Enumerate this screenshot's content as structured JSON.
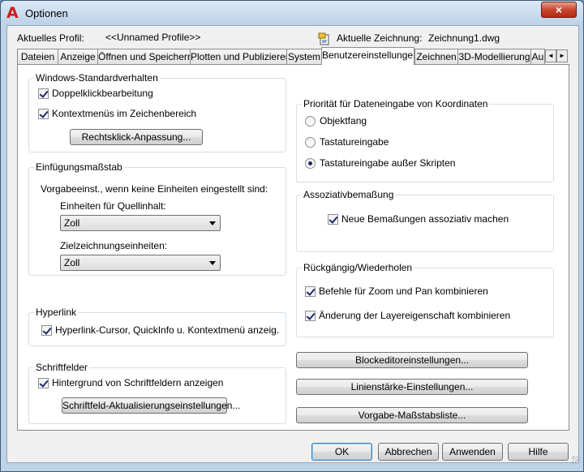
{
  "window": {
    "title": "Optionen",
    "close_label": "×",
    "app_icon_glyph": "A"
  },
  "profile": {
    "current_profile_label": "Aktuelles Profil:",
    "current_profile_value": "<<Unnamed Profile>>",
    "current_drawing_label": "Aktuelle Zeichnung:",
    "current_drawing_value": "Zeichnung1.dwg"
  },
  "tabs": [
    {
      "label": "Dateien"
    },
    {
      "label": "Anzeige"
    },
    {
      "label": "Öffnen und Speichern"
    },
    {
      "label": "Plotten und Publizieren"
    },
    {
      "label": "System"
    },
    {
      "label": "Benutzereinstellungen",
      "active": true
    },
    {
      "label": "Zeichnen"
    },
    {
      "label": "3D-Modellierung"
    },
    {
      "label": "Au"
    }
  ],
  "tab_scroll": {
    "left": "◄",
    "right": "►"
  },
  "windows_behavior": {
    "title": "Windows-Standardverhalten",
    "double_click": "Doppelklickbearbeitung",
    "context_menus": "Kontextmenüs im Zeichenbereich",
    "right_click_button": "Rechtsklick-Anpassung..."
  },
  "insertion_scale": {
    "title": "Einfügungsmaßstab",
    "description": "Vorgabeeinst., wenn keine Einheiten eingestellt sind:",
    "source_label": "Einheiten für Quellinhalt:",
    "source_value": "Zoll",
    "target_label": "Zielzeichnungseinheiten:",
    "target_value": "Zoll"
  },
  "hyperlink": {
    "title": "Hyperlink",
    "option": "Hyperlink-Cursor, QuickInfo u. Kontextmenü anzeig."
  },
  "fields": {
    "title": "Schriftfelder",
    "background": "Hintergrund von Schriftfeldern anzeigen",
    "update_button": "Schriftfeld-Aktualisierungseinstellungen..."
  },
  "coordinate_priority": {
    "title": "Priorität für Dateneingabe von Koordinaten",
    "options": [
      "Objektfang",
      "Tastatureingabe",
      "Tastatureingabe außer Skripten"
    ],
    "selected_index": 2
  },
  "associative_dim": {
    "title": "Assoziativbemaßung",
    "option": "Neue Bemaßungen assoziativ machen"
  },
  "undo_redo": {
    "title": "Rückgängig/Wiederholen",
    "zoom_pan": "Befehle für Zoom und Pan kombinieren",
    "layer_props": "Änderung der Layereigenschaft kombinieren"
  },
  "side_buttons": {
    "block_editor": "Blockeditoreinstellungen...",
    "lineweight": "Linienstärke-Einstellungen...",
    "scale_list": "Vorgabe-Maßstabsliste..."
  },
  "footer": {
    "ok": "OK",
    "cancel": "Abbrechen",
    "apply": "Anwenden",
    "help": "Hilfe"
  }
}
